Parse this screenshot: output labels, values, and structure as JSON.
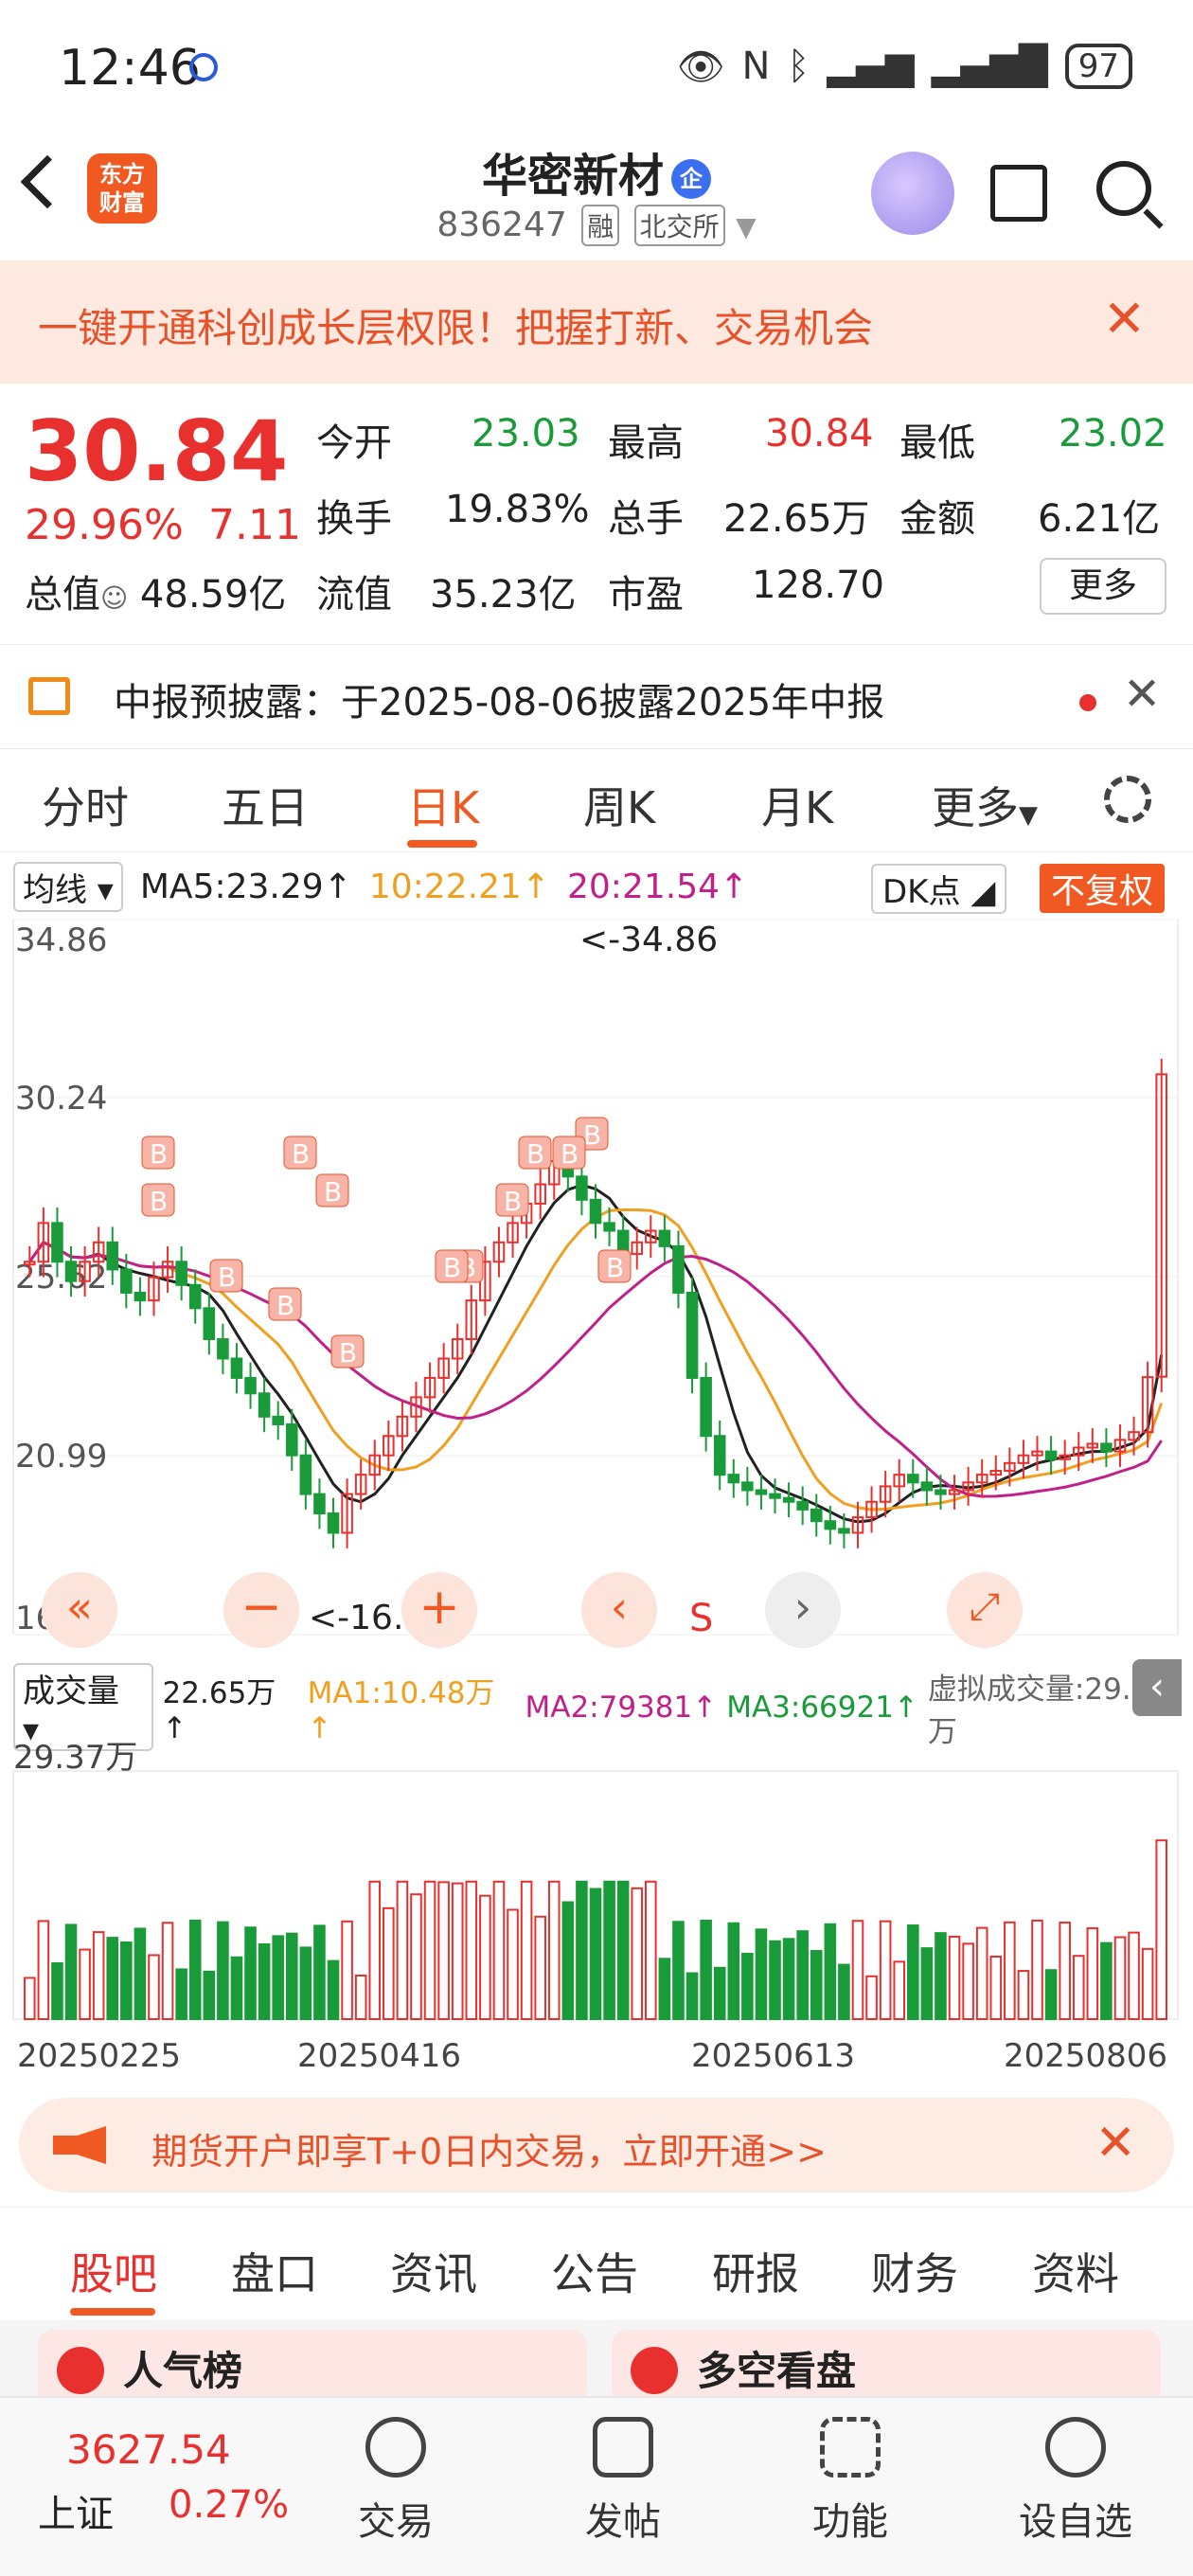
{
  "status_bar": {
    "time": "12:46",
    "battery": "97"
  },
  "header": {
    "logo_line1": "东方",
    "logo_line2": "财富",
    "stock_name": "华密新材",
    "verified_badge": "企",
    "stock_code": "836247",
    "tag_margin": "融",
    "tag_exchange": "北交所"
  },
  "banner": {
    "text": "一键开通科创成长层权限！把握打新、交易机会"
  },
  "quote": {
    "price": "30.84",
    "change_pct": "29.96%",
    "change": "7.11",
    "total_value_label": "总值",
    "total_value": "48.59亿",
    "rows": [
      [
        {
          "label": "今开",
          "value": "23.03",
          "color": "green"
        },
        {
          "label": "最高",
          "value": "30.84",
          "color": "red"
        },
        {
          "label": "最低",
          "value": "23.02",
          "color": "green"
        }
      ],
      [
        {
          "label": "换手",
          "value": "19.83%",
          "color": "black"
        },
        {
          "label": "总手",
          "value": "22.65万",
          "color": "black"
        },
        {
          "label": "金额",
          "value": "6.21亿",
          "color": "black"
        }
      ],
      [
        {
          "label": "流值",
          "value": "35.23亿",
          "color": "black"
        },
        {
          "label": "市盈",
          "value": "128.70",
          "color": "black"
        }
      ]
    ],
    "more_label": "更多"
  },
  "notice": {
    "text": "中报预披露：于2025-08-06披露2025年中报"
  },
  "kline_tabs": [
    "分时",
    "五日",
    "日K",
    "周K",
    "月K",
    "更多"
  ],
  "kline_active": "日K",
  "ma_bar": {
    "selector": "均线",
    "ma5": "MA5:23.29↑",
    "ma10": "10:22.21↑",
    "ma20": "20:21.54↑",
    "dk": "DK点",
    "fq": "不复权"
  },
  "colors": {
    "accent": "#f05a22",
    "up": "#e8312f",
    "down": "#1a9b3a",
    "ma5": "#222222",
    "ma10": "#f0a020",
    "ma20": "#c0208a"
  },
  "chart_data": [
    {
      "type": "candlestick",
      "y_ticks": [
        "34.86",
        "30.24",
        "25.62",
        "20.99",
        "16.37"
      ],
      "ylim": [
        16.37,
        34.86
      ],
      "annotations": {
        "high_label": "<-34.86",
        "low_label": "<-16.37",
        "buy_marker": "B",
        "sell_marker": "S"
      },
      "x_labels": [
        "20250225",
        "20250416",
        "20250613",
        "20250806"
      ],
      "series": [
        {
          "name": "MA5",
          "value": "23.29"
        },
        {
          "name": "MA10",
          "value": "22.21"
        },
        {
          "name": "MA20",
          "value": "21.54"
        }
      ],
      "last_close": 30.84
    },
    {
      "type": "bar",
      "title": "成交量",
      "max_label": "29.37万",
      "current": "22.65万↑",
      "ma1": "MA1:10.48万↑",
      "ma2": "MA2:79381↑",
      "ma3": "MA3:66921↑",
      "virtual": "虚拟成交量:29.37万"
    }
  ],
  "promo": {
    "text": "期货开户即享T+0日内交易，立即开通>>"
  },
  "bottom_tabs": [
    "股吧",
    "盘口",
    "资讯",
    "公告",
    "研报",
    "财务",
    "资料"
  ],
  "cards": [
    {
      "title": "人气榜"
    },
    {
      "title": "多空看盘"
    }
  ],
  "bottom_nav": {
    "index_value": "3627.54",
    "index_name": "上证",
    "index_pct": "0.27%",
    "items": [
      "交易",
      "发帖",
      "功能",
      "设自选"
    ]
  }
}
